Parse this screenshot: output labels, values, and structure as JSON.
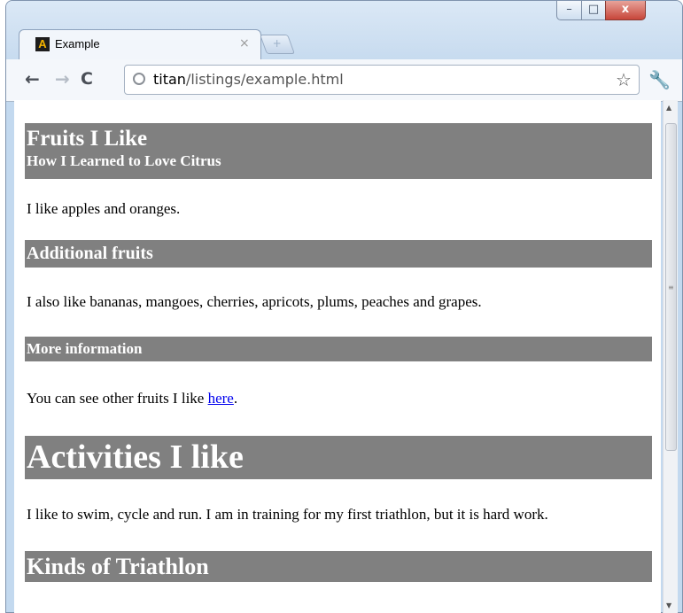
{
  "tab": {
    "favicon": "A",
    "title": "Example",
    "close": "×"
  },
  "new_tab": "+",
  "window_controls": {
    "minimize": "–",
    "maximize": "□",
    "close": "x"
  },
  "toolbar": {
    "back": "←",
    "forward": "→",
    "reload": "C",
    "url_host": "titan",
    "url_path": "/listings/example.html",
    "star": "☆",
    "wrench": "🔧"
  },
  "page": {
    "hgroup_h1": "Fruits I Like",
    "hgroup_h3": "How I Learned to Love Citrus",
    "p1": "I like apples and oranges.",
    "h2_additional": "Additional fruits",
    "p2": "I also like bananas, mangoes, cherries, apricots, plums, peaches and grapes.",
    "h3_more": "More information",
    "p3_before": "You can see other fruits I like ",
    "p3_link": "here",
    "p3_after": ".",
    "h1_activities": "Activities I like",
    "p4": "I like to swim, cycle and run. I am in training for my first triathlon, but it is hard work.",
    "h2_kinds": "Kinds of Triathlon"
  }
}
